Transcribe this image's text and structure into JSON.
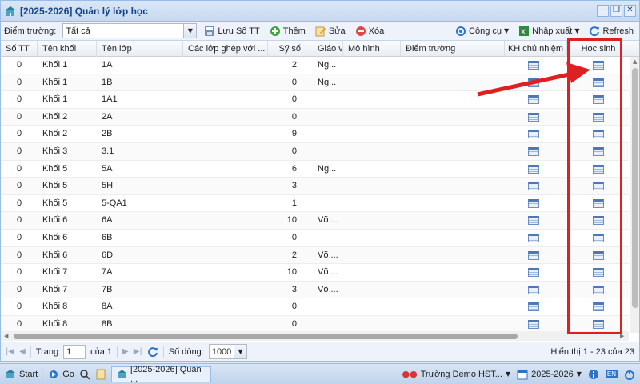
{
  "window": {
    "title": "[2025-2026] Quản lý lớp học",
    "buttons": [
      "—",
      "❐",
      "✕"
    ]
  },
  "toolbar": {
    "school_label": "Điểm trường:",
    "school_value": "Tất cả",
    "save_label": "Lưu Số TT",
    "add_label": "Thêm",
    "edit_label": "Sửa",
    "delete_label": "Xóa",
    "tools_label": "Công cụ",
    "import_export_label": "Nhập xuất",
    "refresh_label": "Refresh"
  },
  "columns": [
    "Số TT",
    "Tên khối",
    "Tên lớp",
    "Các lớp ghép với ...",
    "Sỹ số",
    "Giáo vi",
    "Mô hình",
    "Điểm trường",
    "KH chủ nhiệm",
    "Học sinh"
  ],
  "rows": [
    {
      "stt": "0",
      "khoi": "Khối 1",
      "lop": "1A",
      "ghep": "",
      "siso": "2",
      "gv": "Ng...",
      "mohinh": "",
      "diem": ""
    },
    {
      "stt": "0",
      "khoi": "Khối 1",
      "lop": "1B",
      "ghep": "",
      "siso": "0",
      "gv": "Ng...",
      "mohinh": "",
      "diem": ""
    },
    {
      "stt": "0",
      "khoi": "Khối 1",
      "lop": "1A1",
      "ghep": "",
      "siso": "0",
      "gv": "",
      "mohinh": "",
      "diem": ""
    },
    {
      "stt": "0",
      "khoi": "Khối 2",
      "lop": "2A",
      "ghep": "",
      "siso": "0",
      "gv": "",
      "mohinh": "",
      "diem": ""
    },
    {
      "stt": "0",
      "khoi": "Khối 2",
      "lop": "2B",
      "ghep": "",
      "siso": "9",
      "gv": "",
      "mohinh": "",
      "diem": ""
    },
    {
      "stt": "0",
      "khoi": "Khối 3",
      "lop": "3.1",
      "ghep": "",
      "siso": "0",
      "gv": "",
      "mohinh": "",
      "diem": ""
    },
    {
      "stt": "0",
      "khoi": "Khối 5",
      "lop": "5A",
      "ghep": "",
      "siso": "6",
      "gv": "Ng...",
      "mohinh": "",
      "diem": ""
    },
    {
      "stt": "0",
      "khoi": "Khối 5",
      "lop": "5H",
      "ghep": "",
      "siso": "3",
      "gv": "",
      "mohinh": "",
      "diem": ""
    },
    {
      "stt": "0",
      "khoi": "Khối 5",
      "lop": "5-QA1",
      "ghep": "",
      "siso": "1",
      "gv": "",
      "mohinh": "",
      "diem": ""
    },
    {
      "stt": "0",
      "khoi": "Khối 6",
      "lop": "6A",
      "ghep": "",
      "siso": "10",
      "gv": "Võ ...",
      "mohinh": "",
      "diem": ""
    },
    {
      "stt": "0",
      "khoi": "Khối 6",
      "lop": "6B",
      "ghep": "",
      "siso": "0",
      "gv": "",
      "mohinh": "",
      "diem": ""
    },
    {
      "stt": "0",
      "khoi": "Khối 6",
      "lop": "6D",
      "ghep": "",
      "siso": "2",
      "gv": "Võ ...",
      "mohinh": "",
      "diem": ""
    },
    {
      "stt": "0",
      "khoi": "Khối 7",
      "lop": "7A",
      "ghep": "",
      "siso": "10",
      "gv": "Võ ...",
      "mohinh": "",
      "diem": ""
    },
    {
      "stt": "0",
      "khoi": "Khối 7",
      "lop": "7B",
      "ghep": "",
      "siso": "3",
      "gv": "Võ ...",
      "mohinh": "",
      "diem": ""
    },
    {
      "stt": "0",
      "khoi": "Khối 8",
      "lop": "8A",
      "ghep": "",
      "siso": "0",
      "gv": "",
      "mohinh": "",
      "diem": ""
    },
    {
      "stt": "0",
      "khoi": "Khối 8",
      "lop": "8B",
      "ghep": "",
      "siso": "0",
      "gv": "",
      "mohinh": "",
      "diem": ""
    }
  ],
  "pager": {
    "page_label": "Trang",
    "page_value": "1",
    "of_label": "của 1",
    "rows_label": "Số dòng:",
    "rows_value": "1000",
    "info": "Hiển thị 1 - 23 của 23"
  },
  "taskbar": {
    "start_label": "Start",
    "go_label": "Go",
    "window_label": "[2025-2026] Quản ...",
    "school_label": "Trường Demo HST...",
    "year_label": "2025-2026",
    "lang_label": "EN"
  },
  "colors": {
    "accent": "#15428b",
    "highlight": "#e02020",
    "grid_icon": "#4d78b5"
  }
}
